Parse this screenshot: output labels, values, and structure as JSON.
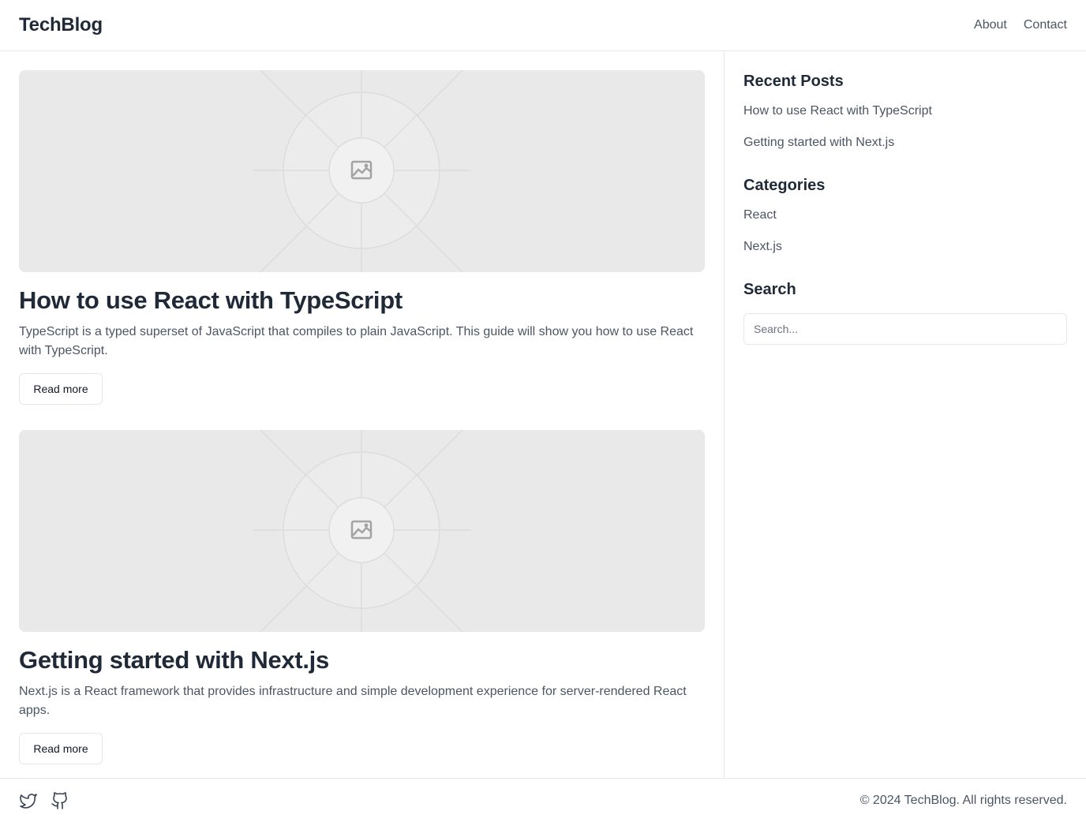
{
  "header": {
    "brand": "TechBlog",
    "nav": [
      {
        "label": "About"
      },
      {
        "label": "Contact"
      }
    ]
  },
  "posts": [
    {
      "title": "How to use React with TypeScript",
      "excerpt": "TypeScript is a typed superset of JavaScript that compiles to plain JavaScript. This guide will show you how to use React with TypeScript.",
      "read_more_label": "Read more",
      "image_icon": "image-placeholder-icon"
    },
    {
      "title": "Getting started with Next.js",
      "excerpt": "Next.js is a React framework that provides infrastructure and simple development experience for server-rendered React apps.",
      "read_more_label": "Read more",
      "image_icon": "image-placeholder-icon"
    }
  ],
  "sidebar": {
    "recent_posts": {
      "heading": "Recent Posts",
      "items": [
        {
          "label": "How to use React with TypeScript"
        },
        {
          "label": "Getting started with Next.js"
        }
      ]
    },
    "categories": {
      "heading": "Categories",
      "items": [
        {
          "label": "React"
        },
        {
          "label": "Next.js"
        }
      ]
    },
    "search": {
      "heading": "Search",
      "placeholder": "Search...",
      "value": ""
    }
  },
  "footer": {
    "socials": [
      {
        "icon": "twitter-icon"
      },
      {
        "icon": "github-icon"
      }
    ],
    "copyright": "© 2024 TechBlog. All rights reserved."
  },
  "colors": {
    "text_primary": "#1f2937",
    "text_secondary": "#4b5563",
    "border": "#e5e7eb",
    "placeholder_bg": "#e9e9e9"
  }
}
